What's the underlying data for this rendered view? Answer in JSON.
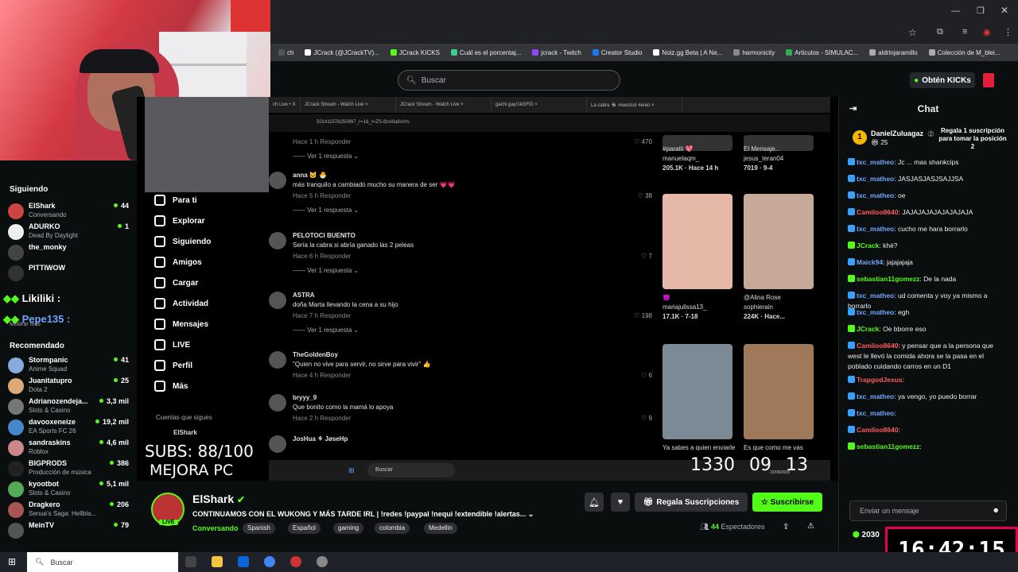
{
  "browser": {
    "bookmarks": [
      {
        "label": "ch",
        "color": "#555"
      },
      {
        "label": "JCrack (@JCrackTV)...",
        "color": "#fff"
      },
      {
        "label": "JCrack KICKS",
        "color": "#53fc18"
      },
      {
        "label": "Cuál es el porcentaj...",
        "color": "#3ecf8e"
      },
      {
        "label": "jcrack - Twitch",
        "color": "#9146ff"
      },
      {
        "label": "Creator Studio",
        "color": "#1877f2"
      },
      {
        "label": "Noiz.gg Beta | A Ne...",
        "color": "#fff"
      },
      {
        "label": "harmonicity",
        "color": "#888"
      },
      {
        "label": "Articulos - SIMULAC...",
        "color": "#34a853"
      },
      {
        "label": "aldrinjaramillo",
        "color": "#aaa"
      },
      {
        "label": "Colección de M_blei...",
        "color": "#aaa"
      }
    ]
  },
  "kick": {
    "search_placeholder": "Buscar",
    "obten_kicks": "Obtén KICKs"
  },
  "sidebar": {
    "following_header": "Siguiendo",
    "following": [
      {
        "name": "ElShark",
        "game": "Conversando",
        "viewers": "44",
        "color": "#c44"
      },
      {
        "name": "ADURKO",
        "game": "Dead By Daylight",
        "viewers": "1",
        "color": "#eee"
      },
      {
        "name": "the_monky",
        "game": "",
        "viewers": "",
        "color": "#444"
      },
      {
        "name": "PITTIWOW",
        "game": "",
        "viewers": "",
        "color": "#333"
      }
    ],
    "overlay_names": [
      "Likiliki :",
      "Pepe135 :"
    ],
    "show_more": "Mostrar más",
    "recommended_header": "Recomendado",
    "recommended": [
      {
        "name": "Stormpanic",
        "game": "Anime Squad",
        "viewers": "41",
        "color": "#8ad"
      },
      {
        "name": "Juanitatupro",
        "game": "Dota 2",
        "viewers": "25",
        "color": "#da7"
      },
      {
        "name": "Adrianozendeja...",
        "game": "Slots & Casino",
        "viewers": "3,3 mil",
        "color": "#777"
      },
      {
        "name": "davooxeneize",
        "game": "EA Sports FC 26",
        "viewers": "19,2 mil",
        "color": "#48c"
      },
      {
        "name": "sandraskins",
        "game": "Roblox",
        "viewers": "4,6 mil",
        "color": "#c88"
      },
      {
        "name": "BIGPRODS",
        "game": "Producción de música",
        "viewers": "386",
        "color": "#222"
      },
      {
        "name": "kyootbot",
        "game": "Slots & Casino",
        "viewers": "5,1 mil",
        "color": "#5a5"
      },
      {
        "name": "Dragkero",
        "game": "Senua's Saga: Hellbla...",
        "viewers": "206",
        "color": "#a55"
      },
      {
        "name": "MeinTV",
        "game": "",
        "viewers": "79",
        "color": "#555"
      }
    ]
  },
  "stream_screen": {
    "tabs": [
      "ch Live • X",
      "JCrack Stream - Watch Live ×",
      "JCrack Stream - Watch Live ×",
      "gachi.gay/1kGFiD ×",
      "La cabra 🐐 #westcol #ereo ×"
    ],
    "url": "501411576250997_r=1&_t=ZS-8zvi0a9oVrs",
    "tiktok_nav": [
      "Para ti",
      "Explorar",
      "Siguiendo",
      "Amigos",
      "Cargar",
      "Actividad",
      "Mensajes",
      "LIVE",
      "Perfil",
      "Más"
    ],
    "cuentas": "Cuentas que sigues",
    "cuentas_user": "ElShark",
    "comments": [
      {
        "name": "",
        "text": "",
        "meta": "Hace 1 h    Responder",
        "likes": "470",
        "reply": "Ver 1 respuesta"
      },
      {
        "name": "anna 🐱 🐣",
        "text": "más tranquilo a cambiado mucho su manera de ser 💗💗",
        "meta": "Hace 5 h    Responder",
        "likes": "38",
        "reply": "Ver 1 respuesta"
      },
      {
        "name": "PELOTOCI BUENITO",
        "text": "Sería la cabra si abría ganado las 2 peleas",
        "meta": "Hace 6 h    Responder",
        "likes": "7",
        "reply": "Ver 1 respuesta"
      },
      {
        "name": "ASTRA",
        "text": "doña Marta llevando la cena a su hijo",
        "meta": "Hace 7 h    Responder",
        "likes": "198",
        "reply": "Ver 1 respuesta"
      },
      {
        "name": "TheGoldenBoy",
        "text": "\"Quien no vive para servir, no sirve para vivir\" 👍",
        "meta": "Hace 4 h    Responder",
        "likes": "6",
        "reply": ""
      },
      {
        "name": "bryyy_9",
        "text": "Que bonito como la mamá lo apoya",
        "meta": "Hace 2 h    Responder",
        "likes": "9",
        "reply": ""
      },
      {
        "name": "JosHua ⚘ JøseHp",
        "text": "",
        "meta": "",
        "likes": "",
        "reply": ""
      }
    ],
    "videos": [
      {
        "title": "#paratii 💖",
        "user": "manuelaqm_",
        "stats": "205.1K · Hace 14 h"
      },
      {
        "title": "El Mensaje...",
        "user": "jesus_teran04",
        "stats": "7019 · 9-4"
      },
      {
        "title": "😈",
        "user": "mariajulissa13_",
        "stats": "17.1K · 7-18"
      },
      {
        "title": "@Alina Rose",
        "user": "sophierain",
        "stats": "224K · Hace..."
      },
      {
        "title": "Ya sabes a quien enviarle",
        "user": "",
        "stats": ""
      },
      {
        "title": "Es que como me vas",
        "user": "LAA",
        "stats": ""
      }
    ],
    "subs_overlay": "SUBS: 88/100",
    "mejora": "MEJORA PC",
    "clock_parts": [
      "1330",
      "09",
      "13"
    ],
    "win_search": "Buscar",
    "win_date": "22/09/2025"
  },
  "chat": {
    "title": "Chat",
    "pinned_user": "DanielZuluagaz",
    "pinned_count": "25",
    "pinned_message": "Regala 1 suscripción para tomar la posición 2",
    "messages": [
      {
        "user": "txc_matheo",
        "text": "Jc ... mas shankcips",
        "cls": "cu"
      },
      {
        "user": "txc_matheo",
        "text": "JASJASJASJSAJJSA",
        "cls": "cu"
      },
      {
        "user": "txc_matheo",
        "text": "oe",
        "cls": "cu"
      },
      {
        "user": "Camiloo8640",
        "text": "JAJAJAJAJAJAJAJAJA",
        "cls": "cr"
      },
      {
        "user": "txc_matheo",
        "text": "cucho me hara borrarlo",
        "cls": "cu"
      },
      {
        "user": "JCrack",
        "text": "khé?",
        "cls": "cg"
      },
      {
        "user": "Maick94",
        "text": "jajajajaja",
        "cls": "cu"
      },
      {
        "user": "sebastian11gomezz",
        "text": "De la nada",
        "cls": "cg"
      },
      {
        "user": "txc_matheo",
        "text": "ud comenta y voy ya mismo a borrarlo",
        "cls": "cu"
      },
      {
        "user": "txc_matheo",
        "text": "egh",
        "cls": "cu"
      },
      {
        "user": "JCrack",
        "text": "Oe bborre eso",
        "cls": "cg"
      },
      {
        "user": "Camiloo8640",
        "text": "y pensar que a la persona que west le llevó la comida ahora se la pasa en el poblado cuidando carros en un D1",
        "cls": "cr"
      },
      {
        "user": "TrapgodJesus",
        "text": "",
        "cls": "cr"
      },
      {
        "user": "txc_matheo",
        "text": "ya vengo, yo puedo borrar",
        "cls": "cu"
      },
      {
        "user": "txc_matheo",
        "text": "",
        "cls": "cu"
      },
      {
        "user": "Camiloo8640",
        "text": "",
        "cls": "cr"
      },
      {
        "user": "sebastian11gomezz",
        "text": "",
        "cls": "cg"
      }
    ],
    "input_placeholder": "Enviar un mensaje",
    "points": "2030",
    "timer": "16:42:15"
  },
  "channel": {
    "name": "ElShark",
    "title": "CONTINUAMOS CON EL WUKONG Y MÁS TARDE IRL | !redes !paypal !nequi !extendible !alertas...",
    "category": "Conversando",
    "tags": [
      "Spanish",
      "Español",
      "gaming",
      "colombia",
      "Medellin"
    ],
    "gift_label": "Regala Suscripciones",
    "subscribe_label": "Suscribirse",
    "viewers": "44",
    "viewers_label": "Espectadores",
    "live_badge": "LIVE"
  },
  "taskbar": {
    "search": "Buscar"
  }
}
